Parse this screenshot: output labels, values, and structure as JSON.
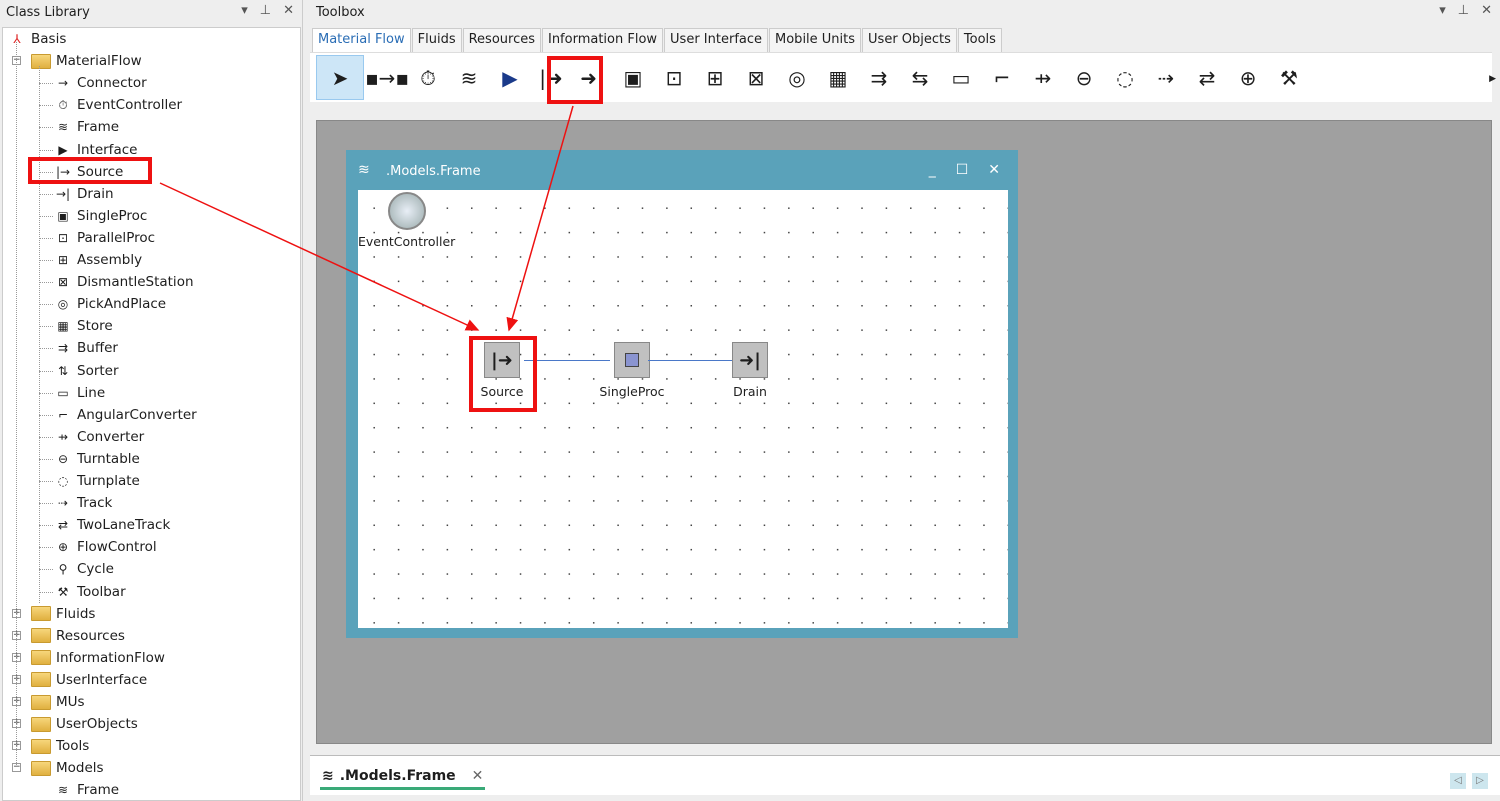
{
  "class_library": {
    "title": "Class Library",
    "root": "Basis",
    "material_flow": {
      "label": "MaterialFlow",
      "children": [
        {
          "label": "Connector",
          "icon": "connector-icon",
          "glyph": "→"
        },
        {
          "label": "EventController",
          "icon": "stopwatch-icon",
          "glyph": "⏱"
        },
        {
          "label": "Frame",
          "icon": "frame-icon",
          "glyph": "≋"
        },
        {
          "label": "Interface",
          "icon": "interface-icon",
          "glyph": "▶"
        },
        {
          "label": "Source",
          "icon": "source-icon",
          "glyph": "|→"
        },
        {
          "label": "Drain",
          "icon": "drain-icon",
          "glyph": "→|"
        },
        {
          "label": "SingleProc",
          "icon": "singleproc-icon",
          "glyph": "▣"
        },
        {
          "label": "ParallelProc",
          "icon": "parallelproc-icon",
          "glyph": "⊡"
        },
        {
          "label": "Assembly",
          "icon": "assembly-icon",
          "glyph": "⊞"
        },
        {
          "label": "DismantleStation",
          "icon": "dismantle-icon",
          "glyph": "⊠"
        },
        {
          "label": "PickAndPlace",
          "icon": "pickandplace-icon",
          "glyph": "◎"
        },
        {
          "label": "Store",
          "icon": "store-icon",
          "glyph": "▦"
        },
        {
          "label": "Buffer",
          "icon": "buffer-icon",
          "glyph": "⇉"
        },
        {
          "label": "Sorter",
          "icon": "sorter-icon",
          "glyph": "⇅"
        },
        {
          "label": "Line",
          "icon": "line-icon",
          "glyph": "▭"
        },
        {
          "label": "AngularConverter",
          "icon": "angular-converter-icon",
          "glyph": "⌐"
        },
        {
          "label": "Converter",
          "icon": "converter-icon",
          "glyph": "⇸"
        },
        {
          "label": "Turntable",
          "icon": "turntable-icon",
          "glyph": "⊖"
        },
        {
          "label": "Turnplate",
          "icon": "turnplate-icon",
          "glyph": "◌"
        },
        {
          "label": "Track",
          "icon": "track-icon",
          "glyph": "⇢"
        },
        {
          "label": "TwoLaneTrack",
          "icon": "twolanetrack-icon",
          "glyph": "⇄"
        },
        {
          "label": "FlowControl",
          "icon": "flowcontrol-icon",
          "glyph": "⊕"
        },
        {
          "label": "Cycle",
          "icon": "cycle-icon",
          "glyph": "⚲"
        },
        {
          "label": "Toolbar",
          "icon": "toolbar-icon",
          "glyph": "⚒"
        }
      ]
    },
    "folders": [
      "Fluids",
      "Resources",
      "InformationFlow",
      "UserInterface",
      "MUs",
      "UserObjects",
      "Tools",
      "Models"
    ],
    "models_children": [
      "Frame"
    ]
  },
  "toolbox": {
    "title": "Toolbox",
    "tabs": [
      "Material Flow",
      "Fluids",
      "Resources",
      "Information Flow",
      "User Interface",
      "Mobile Units",
      "User Objects",
      "Tools"
    ],
    "active_tab": "Material Flow",
    "icons": [
      {
        "name": "pointer-icon",
        "glyph": "➤"
      },
      {
        "name": "connector-icon",
        "glyph": "▪→▪"
      },
      {
        "name": "stopwatch-icon",
        "glyph": "⏱"
      },
      {
        "name": "frame-icon",
        "glyph": "≋"
      },
      {
        "name": "interface-icon",
        "glyph": "▶"
      },
      {
        "name": "source-icon",
        "glyph": "|➜"
      },
      {
        "name": "drain-icon",
        "glyph": "➜|"
      },
      {
        "name": "singleproc-icon",
        "glyph": "▣"
      },
      {
        "name": "parallelproc-icon",
        "glyph": "⊡"
      },
      {
        "name": "assembly-icon",
        "glyph": "⊞"
      },
      {
        "name": "dismantle-icon",
        "glyph": "⊠"
      },
      {
        "name": "pickandplace-icon",
        "glyph": "◎"
      },
      {
        "name": "store-icon",
        "glyph": "▦"
      },
      {
        "name": "buffer-icon",
        "glyph": "⇉"
      },
      {
        "name": "sorter-icon",
        "glyph": "⇆"
      },
      {
        "name": "line-icon",
        "glyph": "▭"
      },
      {
        "name": "angular-converter-icon",
        "glyph": "⌐"
      },
      {
        "name": "converter-icon",
        "glyph": "⇸"
      },
      {
        "name": "turntable-icon",
        "glyph": "⊖"
      },
      {
        "name": "turnplate-icon",
        "glyph": "◌"
      },
      {
        "name": "track-icon",
        "glyph": "⇢"
      },
      {
        "name": "twolanetrack-icon",
        "glyph": "⇄"
      },
      {
        "name": "flowcontrol-icon",
        "glyph": "⊕"
      },
      {
        "name": "toolbar-icon",
        "glyph": "⚒"
      }
    ]
  },
  "frame_window": {
    "title": ".Models.Frame",
    "objects": [
      {
        "label": "EventController"
      },
      {
        "label": "Source"
      },
      {
        "label": "SingleProc"
      },
      {
        "label": "Drain"
      }
    ]
  },
  "document_tab": {
    "label": ".Models.Frame"
  },
  "colors": {
    "highlight": "#ee1111",
    "frame_titlebar": "#5aa2ba",
    "active_tab_underline": "#3aaa78"
  }
}
